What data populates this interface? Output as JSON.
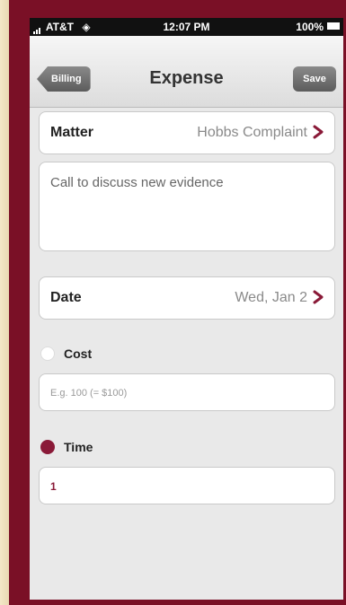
{
  "status_bar": {
    "carrier": "AT&T",
    "time": "12:07 PM",
    "battery": "100%"
  },
  "nav": {
    "back_label": "Billing",
    "title": "Expense",
    "save_label": "Save"
  },
  "matter": {
    "label": "Matter",
    "value": "Hobbs Complaint"
  },
  "description": {
    "text": "Call to discuss new evidence"
  },
  "date": {
    "label": "Date",
    "value": "Wed, Jan 2"
  },
  "cost": {
    "label": "Cost",
    "placeholder": "E.g. 100 (= $100)",
    "selected": false
  },
  "time_field": {
    "label": "Time",
    "value": "1",
    "selected": true
  },
  "colors": {
    "accent": "#8a1a38",
    "frame": "#7a1026",
    "background": "#efe3c4"
  }
}
